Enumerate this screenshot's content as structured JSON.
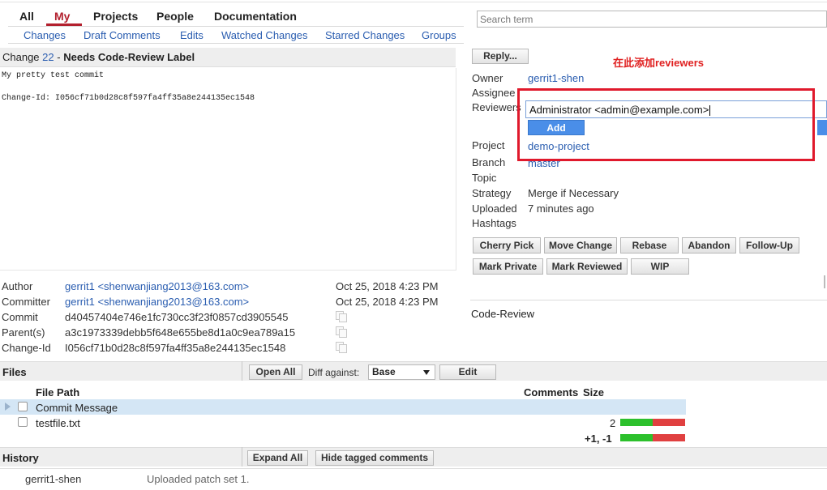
{
  "nav": {
    "tabs": [
      "All",
      "My",
      "Projects",
      "People",
      "Documentation"
    ],
    "subtabs": [
      "Changes",
      "Draft Comments",
      "Edits",
      "Watched Changes",
      "Starred Changes",
      "Groups"
    ]
  },
  "search": {
    "placeholder": "Search term"
  },
  "change": {
    "prefix": "Change",
    "number": "22",
    "status": "Needs Code-Review Label",
    "message_line1": "My pretty test commit",
    "message_line2": "Change-Id: I056cf71b0d28c8f597fa4ff35a8e244135ec1548"
  },
  "reply_label": "Reply...",
  "annotation": "在此添加reviewers",
  "meta": {
    "owner_label": "Owner",
    "owner_value": "gerrit1-shen",
    "assignee_label": "Assignee",
    "reviewers_label": "Reviewers",
    "reviewer_input": "Administrator <admin@example.com>",
    "add_label": "Add",
    "project_label": "Project",
    "project_value": "demo-project",
    "branch_label": "Branch",
    "branch_value": "master",
    "topic_label": "Topic",
    "strategy_label": "Strategy",
    "strategy_value": "Merge if Necessary",
    "uploaded_label": "Uploaded",
    "uploaded_value": "7 minutes ago",
    "hashtags_label": "Hashtags"
  },
  "actions": {
    "row1": [
      "Cherry Pick",
      "Move Change",
      "Rebase",
      "Abandon",
      "Follow-Up"
    ],
    "row2": [
      "Mark Private",
      "Mark Reviewed",
      "WIP"
    ]
  },
  "code_review_label": "Code-Review",
  "info": {
    "author_label": "Author",
    "author_value": "gerrit1 <shenwanjiang2013@163.com>",
    "author_date": "Oct 25, 2018 4:23 PM",
    "committer_label": "Committer",
    "committer_value": "gerrit1 <shenwanjiang2013@163.com>",
    "committer_date": "Oct 25, 2018 4:23 PM",
    "commit_label": "Commit",
    "commit_value": "d40457404e746e1fc730cc3f23f0857cd3905545",
    "parent_label": "Parent(s)",
    "parent_value": "a3c1973339debb5f648e655be8d1a0c9ea789a15",
    "changeid_label": "Change-Id",
    "changeid_value": "I056cf71b0d28c8f597fa4ff35a8e244135ec1548"
  },
  "files": {
    "title": "Files",
    "open_all": "Open All",
    "diff_against_label": "Diff against:",
    "diff_against_value": "Base",
    "edit_label": "Edit",
    "col_path": "File Path",
    "col_comments": "Comments",
    "col_size": "Size",
    "rows": [
      {
        "path": "Commit Message",
        "comments": "",
        "highlighted": true
      },
      {
        "path": "testfile.txt",
        "comments": "2"
      }
    ],
    "total": "+1, -1"
  },
  "history": {
    "title": "History",
    "expand_all": "Expand All",
    "hide_tagged": "Hide tagged comments",
    "entries": [
      {
        "user": "gerrit1-shen",
        "text": "Uploaded patch set 1."
      }
    ]
  },
  "colors": {
    "link": "#2a5db0",
    "accent": "#b3202e",
    "annotation": "#e02020",
    "add_button": "#4a8ee8"
  }
}
